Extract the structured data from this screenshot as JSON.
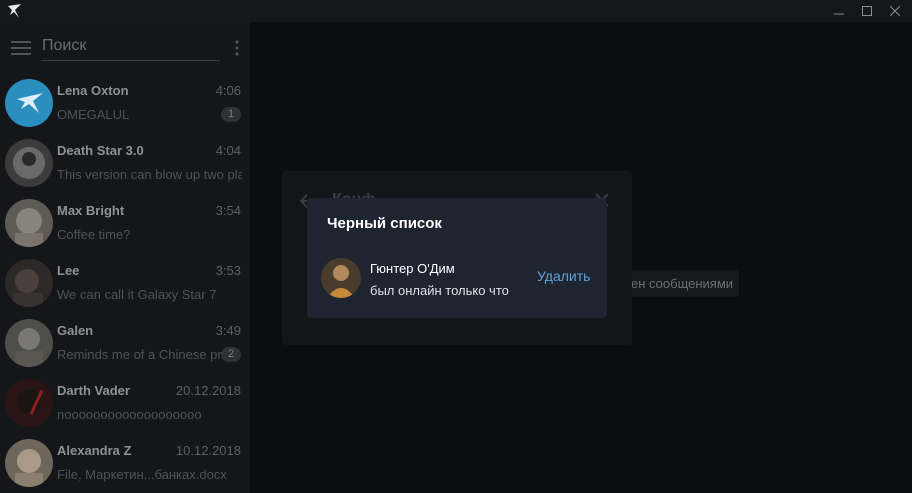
{
  "window": {
    "minimize_icon": "minimize-icon",
    "maximize_icon": "maximize-icon",
    "close_icon": "close-icon"
  },
  "sidebar": {
    "search_placeholder": "Поиск",
    "chats": [
      {
        "name": "Lena Oxton",
        "time": "4:06",
        "message": "OMEGALUL",
        "badge": "1",
        "avatar_color": "#2a8fbf"
      },
      {
        "name": "Death Star 3.0",
        "time": "4:04",
        "message": "This version can blow up two pla",
        "badge": "",
        "avatar_color": "#4a4a4a"
      },
      {
        "name": "Max Bright",
        "time": "3:54",
        "message": "Coffee time?",
        "badge": "",
        "avatar_color": "#6a6560"
      },
      {
        "name": "Lee",
        "time": "3:53",
        "message": "We can call it Galaxy Star 7",
        "badge": "",
        "avatar_color": "#3a3434"
      },
      {
        "name": "Galen",
        "time": "3:49",
        "message": "Reminds me of a Chinese pro",
        "badge": "2",
        "avatar_color": "#5a5a55"
      },
      {
        "name": "Darth Vader",
        "time": "20.12.2018",
        "message": "nooooooooooooooooooo",
        "badge": "",
        "avatar_color": "#3a1a1a"
      },
      {
        "name": "Alexandra Z",
        "time": "10.12.2018",
        "message": "File, Маркетин...банках.docx",
        "badge": "",
        "avatar_color": "#7a7060"
      }
    ]
  },
  "background_panel": {
    "title": "Конф",
    "item_text": "р",
    "pill_text": "ен сообщениями"
  },
  "dialog": {
    "title": "Черный список",
    "user_name": "Гюнтер О'Дим",
    "user_status": "был онлайн только что",
    "remove_label": "Удалить",
    "accent_color": "#5aa2e0"
  }
}
